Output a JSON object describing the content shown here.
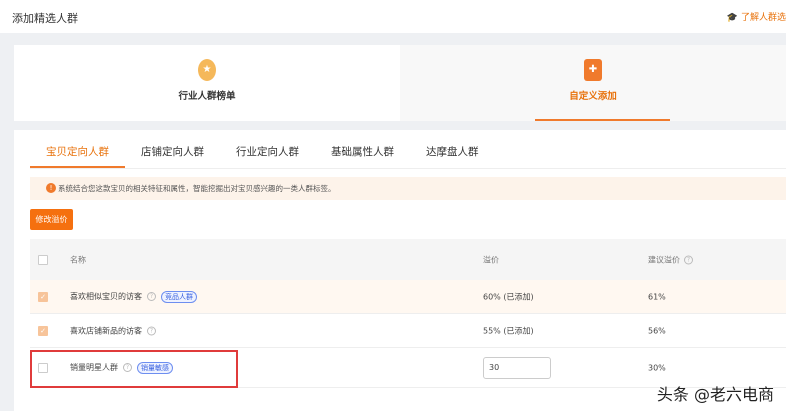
{
  "header": {
    "title": "添加精选人群",
    "help_link": "了解人群选"
  },
  "mode_tabs": [
    {
      "label": "行业人群榜单",
      "icon": "medal-icon"
    },
    {
      "label": "自定义添加",
      "icon": "puzzle-icon",
      "active": true
    }
  ],
  "sub_tabs": [
    "宝贝定向人群",
    "店铺定向人群",
    "行业定向人群",
    "基础属性人群",
    "达摩盘人群"
  ],
  "info": "系统结合您这款宝贝的相关特征和属性，智能挖掘出对宝贝感兴趣的一类人群标签。",
  "modify_button": "修改溢价",
  "table": {
    "headers": {
      "name": "名称",
      "premium": "溢价",
      "suggested": "建议溢价"
    },
    "rows": [
      {
        "name": "喜欢相似宝贝的访客",
        "tag": "竞品人群",
        "premium": "60% (已添加)",
        "suggested": "61%",
        "checked": true
      },
      {
        "name": "喜欢店铺新品的访客",
        "tag": "",
        "premium": "55% (已添加)",
        "suggested": "56%",
        "checked": true
      },
      {
        "name": "销量明星人群",
        "tag": "销量敏感",
        "premium_input": "30",
        "suggested": "30%",
        "checked": false
      }
    ]
  },
  "watermark": "头条 @老六电商",
  "colors": {
    "accent": "#f07a2c",
    "highlight": "#e03b3b",
    "tag": "#3a62e0"
  }
}
